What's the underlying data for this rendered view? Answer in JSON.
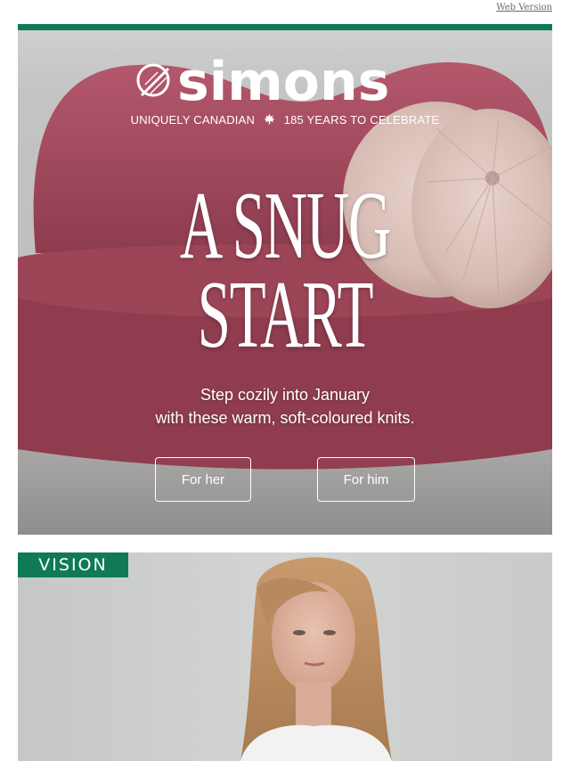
{
  "header": {
    "web_version_label": "Web Version",
    "accent_color": "#0f7a55"
  },
  "hero": {
    "brand": "simons",
    "tagline_left": "UNIQUELY CANADIAN",
    "tagline_right": "185 YEARS TO CELEBRATE",
    "headline_line1": "A SNUG",
    "headline_line2": "START",
    "subtext_line1": "Step cozily into January",
    "subtext_line2": "with these warm, soft-coloured knits.",
    "buttons": {
      "her": "For her",
      "him": "For him"
    }
  },
  "second": {
    "badge": "VISION"
  }
}
